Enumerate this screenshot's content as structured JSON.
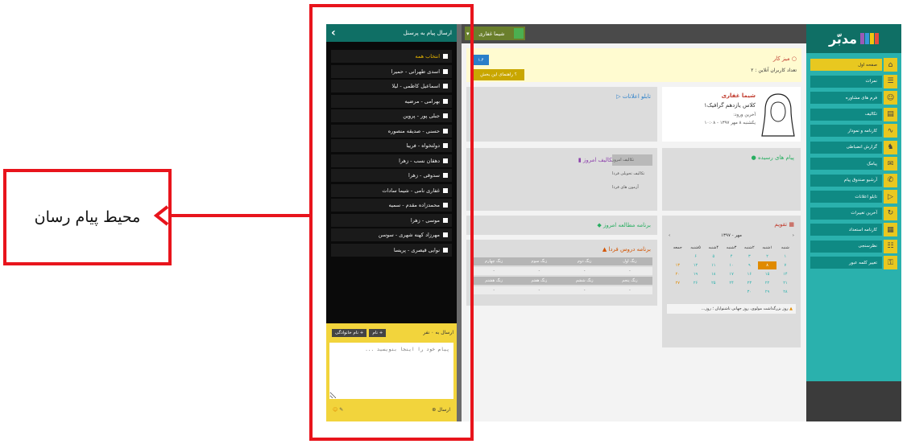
{
  "callout": {
    "text": "محیط پیام رسان"
  },
  "messenger": {
    "title": "ارسال پیام به پرسنل",
    "select_all": "انتخاب همه",
    "recipients": [
      "اسدی طهرانی - حمیرا",
      "اسماعیل کاظمی - لیلا",
      "بهرامی - مرضیه",
      "جبلی پور - پروین",
      "حسنی - صدیقه منصوره",
      "دولتخواه - فریبا",
      "دهقان نسب - زهرا",
      "سدوقی - زهرا",
      "غفاری نامی - شیما سادات",
      "محمدزاده مقدم - سمیه",
      "موسی - زهرا",
      "مهرزاد کهنه شهری - سوسن",
      "نوایی قیصری - پریسا"
    ],
    "send_to_count": "ارسال به ۰ نفر",
    "name_button": "+ نام",
    "family_button": "+ نام خانوادگی",
    "textarea_placeholder": "پیام خود را اینجا بنویسید ...",
    "send_label": "ارسال"
  },
  "topbar": {
    "user_name": "شیما غفاری"
  },
  "logo": {
    "text": "مدبّر",
    "colors": [
      "#e84c3d",
      "#f1c40f",
      "#3498db",
      "#9b59b6"
    ]
  },
  "sidebar": {
    "items": [
      {
        "label": "صفحه اول",
        "icon": "⌂"
      },
      {
        "label": "نمرات",
        "icon": "☰"
      },
      {
        "label": "فرم های مشاوره",
        "icon": "☺"
      },
      {
        "label": "تکالیف",
        "icon": "▤"
      },
      {
        "label": "کارنامه و نمودار",
        "icon": "∿"
      },
      {
        "label": "گزارش انضباطی",
        "icon": "♞"
      },
      {
        "label": "پیامک",
        "icon": "✉"
      },
      {
        "label": "آرشیو صندوق پیام",
        "icon": "✆"
      },
      {
        "label": "تابلو اعلانات",
        "icon": "▷"
      },
      {
        "label": "آخرین تغییرات",
        "icon": "↻"
      },
      {
        "label": "کارنامه استعداد",
        "icon": "▦"
      },
      {
        "label": "نظرسنجی",
        "icon": "☷"
      },
      {
        "label": "تغییر کلمه عبور",
        "icon": "⚿"
      }
    ]
  },
  "main": {
    "desk_title": "میز کار",
    "online_count": "تعداد کاربران آنلاین : ۲",
    "guide_button": "راهنمای این بخش",
    "version_badge": "۱.۴",
    "profile": {
      "name": "شیما غفاری",
      "class": "کلاس یازدهم گرافیک۱",
      "login_label": "آخرین ورود:",
      "login_date": "یکشنبه ۸ مهر ۱۳۹۷ - ۱۰:۰۸"
    },
    "notice_title": "تابلو اعلانات",
    "messages_title": "پیام های رسیده",
    "today_tasks": {
      "title": "تکالیف امروز",
      "tabs": [
        "تکالیف امروز",
        "تکالیف تحویلی فردا",
        "آزمون های فردا"
      ]
    },
    "study_title": "برنامه مطالعه امروز",
    "tomorrow": {
      "title": "برنامه دروس فردا",
      "headers_row1": [
        "زنگ اول",
        "زنگ دوم",
        "زنگ سوم",
        "زنگ چهارم"
      ],
      "headers_row2": [
        "زنگ پنجم",
        "زنگ ششم",
        "زنگ هفتم",
        "زنگ هشتم"
      ],
      "empty": "-"
    },
    "calendar": {
      "title": "تقویم",
      "month": "مهر - ۱۳۹۷",
      "prev": "‹",
      "next": "›",
      "weekdays": [
        "شنبه",
        "۱شنبه",
        "۲شنبه",
        "۳شنبه",
        "۴شنبه",
        "۵شنبه",
        "جمعه"
      ],
      "weeks": [
        [
          "۱",
          "۲",
          "۳",
          "۴",
          "۵",
          "۶",
          ""
        ],
        [
          "۷",
          "۸",
          "۹",
          "۱۰",
          "۱۱",
          "۱۲",
          "۱۳"
        ],
        [
          "۱۴",
          "۱۵",
          "۱۶",
          "۱۷",
          "۱۸",
          "۱۹",
          "۲۰"
        ],
        [
          "۲۱",
          "۲۲",
          "۲۳",
          "۲۴",
          "۲۵",
          "۲۶",
          "۲۷"
        ],
        [
          "۲۸",
          "۲۹",
          "۳۰",
          "",
          "",
          "",
          ""
        ]
      ],
      "event": "روز بزرگداشت مولوی، روز جهانی ناشنوایان ؛ روز..."
    }
  }
}
